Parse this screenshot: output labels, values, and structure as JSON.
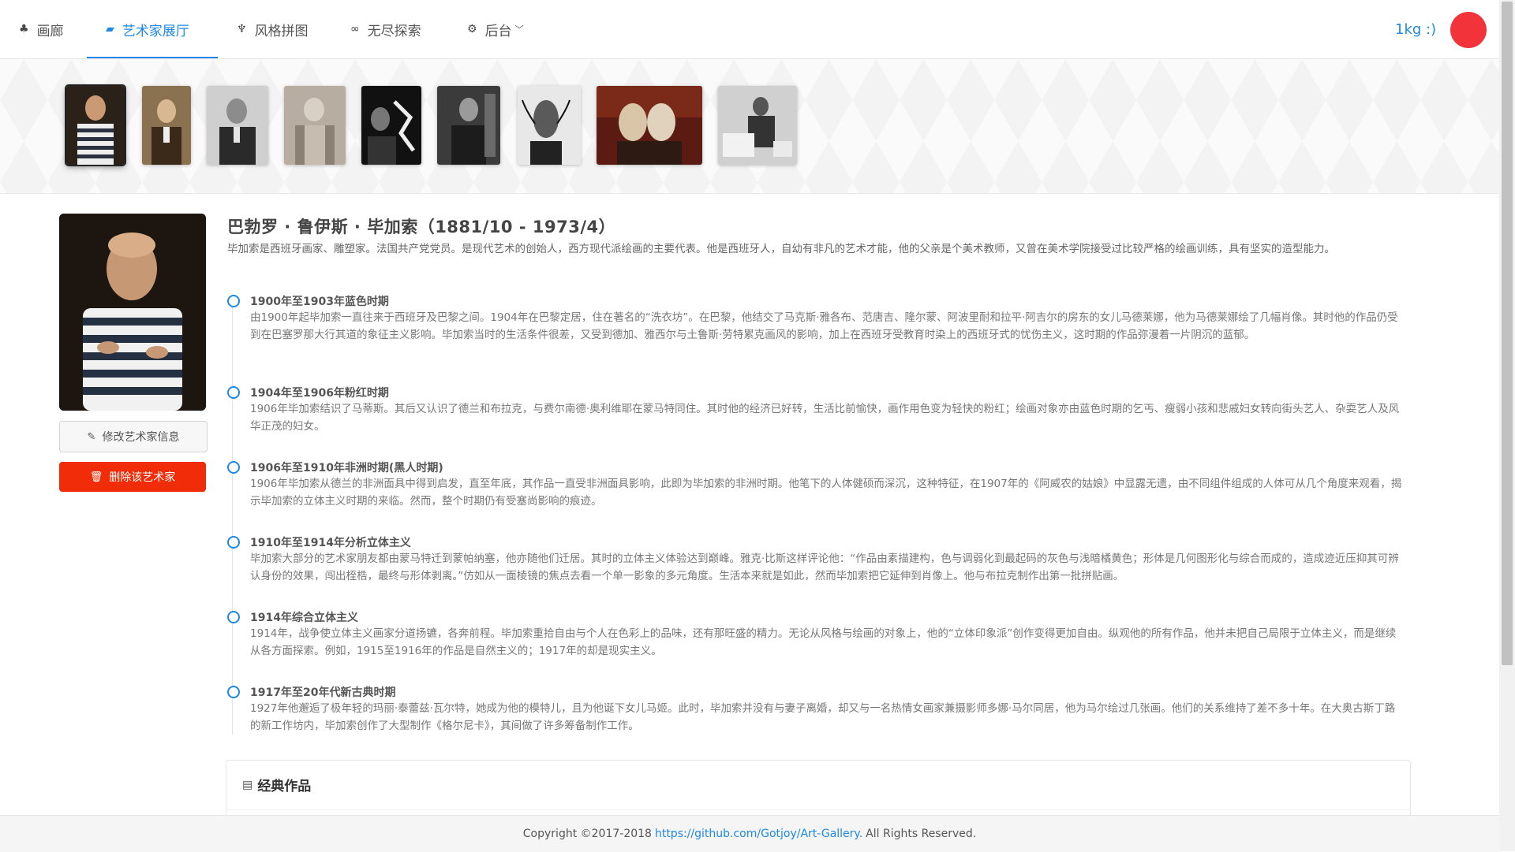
{
  "nav": {
    "items": [
      {
        "icon": "palette-icon",
        "glyph": "♣",
        "label": "画廊"
      },
      {
        "icon": "easel-icon",
        "glyph": "▰",
        "label": "艺术家展厅"
      },
      {
        "icon": "brush-icon",
        "glyph": "♆",
        "label": "风格拼图"
      },
      {
        "icon": "infinity-icon",
        "glyph": "∞",
        "label": "无尽探索"
      },
      {
        "icon": "gear-icon",
        "glyph": "⚙",
        "label": "后台"
      }
    ],
    "user": "1kg :)",
    "avatar_color": "#f3333a",
    "accent": "#1e88e5"
  },
  "artist": {
    "title": "巴勃罗 · 鲁伊斯 · 毕加索（1881/10 - 1973/4）",
    "description": "毕加索是西班牙画家、雕塑家。法国共产党党员。是现代艺术的创始人，西方现代派绘画的主要代表。他是西班牙人，自幼有非凡的艺术才能，他的父亲是个美术教师，又曾在美术学院接受过比较严格的绘画训练，具有坚实的造型能力。",
    "edit_label": "修改艺术家信息",
    "delete_label": "删除该艺术家",
    "delete_color": "#f02d08"
  },
  "timeline": [
    {
      "title": "1900年至1903年蓝色时期",
      "body": "由1900年起毕加索一直往来于西班牙及巴黎之间。1904年在巴黎定居，住在著名的“洗衣坊”。在巴黎，他结交了马克斯·雅各布、范唐吉、隆尔蒙、阿波里耐和拉平·阿吉尔的房东的女儿马德莱娜，他为马德莱娜绘了几幅肖像。其时他的作品仍受到在巴塞罗那大行其道的象征主义影响。毕加索当时的生活条件很差，又受到德加、雅西尔与土鲁斯·劳特累克画风的影响，加上在西班牙受教育时染上的西班牙式的忧伤主义，这时期的作品弥漫着一片阴沉的蓝郁。"
    },
    {
      "title": "1904年至1906年粉红时期",
      "body": "1906年毕加索结识了马蒂斯。其后又认识了德兰和布拉克，与费尔南德·奥利维耶在蒙马特同住。其时他的经济已好转，生活比前愉快，画作用色变为轻快的粉红；绘画对象亦由蓝色时期的乞丐、瘦弱小孩和悲戚妇女转向街头艺人、杂耍艺人及风华正茂的妇女。"
    },
    {
      "title": "1906年至1910年非洲时期(黑人时期)",
      "body": "1906年毕加索从德兰的非洲面具中得到启发，直至年底，其作品一直受非洲面具影响，此即为毕加索的非洲时期。他笔下的人体健硕而深沉，这种特征，在1907年的《阿威农的姑娘》中显露无遗，由不同组件组成的人体可从几个角度来观看，揭示毕加索的立体主义时期的来临。然而，整个时期仍有受塞尚影响的痕迹。"
    },
    {
      "title": "1910年至1914年分析立体主义",
      "body": "毕加索大部分的艺术家朋友都由蒙马特迁到蒙帕纳塞，他亦随他们迁居。其时的立体主义体验达到巅峰。雅克·比斯这样评论他：“作品由素描建构，色与调弱化到最起码的灰色与浅暗橘黄色；形体是几何图形化与综合而成的，造成迹近压抑其可辨认身份的效果，闯出桎梏，最终与形体剥离。”仿如从一面棱镜的焦点去看一个单一影象的多元角度。生活本来就是如此，然而毕加索把它延伸到肖像上。他与布拉克制作出第一批拼贴画。"
    },
    {
      "title": "1914年综合立体主义",
      "body": "1914年，战争使立体主义画家分道扬镳，各奔前程。毕加索重拾自由与个人在色彩上的品味，还有那旺盛的精力。无论从风格与绘画的对象上，他的“立体印象派”创作变得更加自由。纵观他的所有作品，他并未把自己局限于立体主义，而是继续从各方面探索。例如，1915至1916年的作品是自然主义的；1917年的却是现实主义。"
    },
    {
      "title": "1917年至20年代新古典时期",
      "body": "1927年他邂逅了极年轻的玛丽·泰蕾兹·瓦尔特，她成为他的模特儿，且为他诞下女儿马姬。此时，毕加索并没有与妻子离婚，却又与一名热情女画家兼摄影师多娜·马尔同居，他为马尔绘过几张画。他们的关系维持了差不多十年。在大奥古斯丁路的新工作坊内，毕加索创作了大型制作《格尔尼卡》，其间做了许多筹备制作工作。"
    }
  ],
  "works": {
    "icon": "film-icon",
    "glyph": "▤",
    "title": "经典作品"
  },
  "footer": {
    "prefix": "Copyright ©2017-2018",
    "link": "https://github.com/Gotjoy/Art-Gallery.",
    "suffix": "All Rights Reserved."
  }
}
